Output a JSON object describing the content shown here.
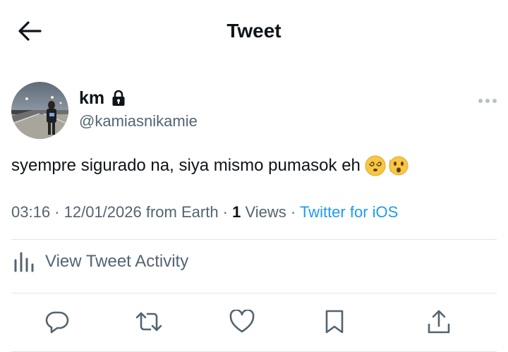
{
  "header": {
    "title": "Tweet",
    "back_icon": "arrow-left-icon"
  },
  "author": {
    "name": "km",
    "handle": "@kamiasnikamie",
    "protected_icon": "lock-icon"
  },
  "tweet": {
    "text": "syempre sigurado na, siya mismo pumasok eh",
    "emojis": [
      "dizzy-face-emoji",
      "astonished-face-emoji"
    ]
  },
  "meta": {
    "time": "03:16",
    "separator": " · ",
    "date": "12/01/2026",
    "location": "from Earth",
    "views_count": "1",
    "views_label": "Views",
    "source": "Twitter for iOS"
  },
  "activity": {
    "label": "View Tweet Activity",
    "icon": "bar-chart-icon"
  },
  "actions": {
    "reply_icon": "reply-icon",
    "retweet_icon": "retweet-icon",
    "like_icon": "heart-icon",
    "bookmark_icon": "bookmark-icon",
    "share_icon": "share-icon"
  },
  "colors": {
    "link": "#1d9bf0",
    "secondary_text": "#536471",
    "primary_text": "#0f1419",
    "divider": "#e1e6ea"
  }
}
